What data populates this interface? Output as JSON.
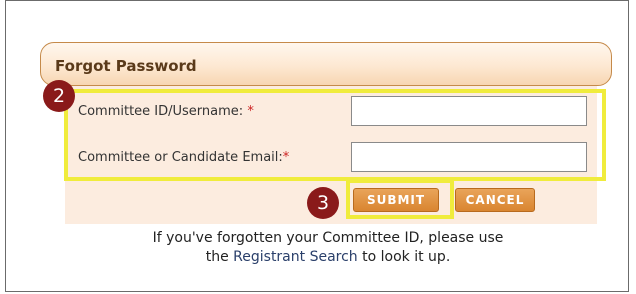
{
  "form": {
    "title": "Forgot Password",
    "fields": [
      {
        "label": "Committee ID/Username:",
        "required_mark": "*",
        "value": ""
      },
      {
        "label": "Committee or Candidate Email:",
        "required_mark": "*",
        "value": ""
      }
    ],
    "submit_label": "SUBMIT",
    "cancel_label": "CANCEL"
  },
  "help": {
    "text_before": "If you've forgotten your Committee ID, please use",
    "text_the": "the",
    "link_text": "Registrant Search",
    "text_after": "to look it up."
  },
  "annotations": {
    "step_2": "2",
    "step_3": "3",
    "highlight_color": "#f0ec3c",
    "badge_color": "#8a1a1a"
  },
  "colors": {
    "button": "#d98530",
    "panel_background": "#fcecdf",
    "required": "#cc2222"
  }
}
